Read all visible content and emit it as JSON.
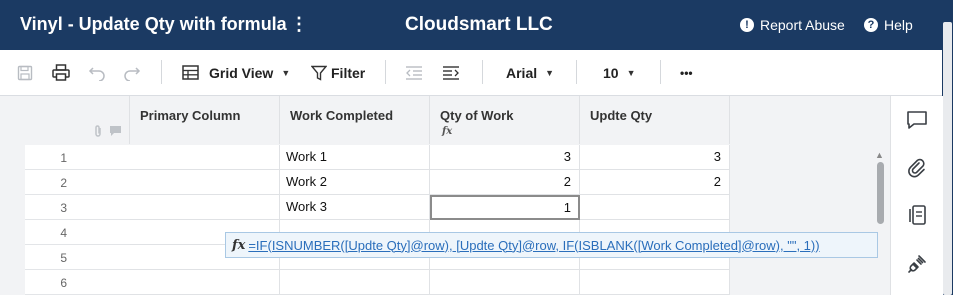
{
  "header": {
    "sheet_title": "Vinyl - Update Qty with formula",
    "menu_glyph": "⋮",
    "company": "Cloudsmart LLC",
    "report_abuse": "Report Abuse",
    "help": "Help",
    "report_icon_glyph": "!",
    "help_icon_glyph": "?"
  },
  "toolbar": {
    "view_label": "Grid View",
    "filter_label": "Filter",
    "font_label": "Arial",
    "font_size": "10",
    "more_label": "•••"
  },
  "columns": [
    {
      "label": "Primary Column",
      "formula": false
    },
    {
      "label": "Work Completed",
      "formula": false
    },
    {
      "label": "Qty of Work",
      "formula": true
    },
    {
      "label": "Updte Qty",
      "formula": false
    }
  ],
  "fx_glyph": "fx",
  "rows": [
    {
      "num": "1",
      "primary": "",
      "work": "Work 1",
      "qty": "3",
      "update": "3"
    },
    {
      "num": "2",
      "primary": "",
      "work": "Work 2",
      "qty": "2",
      "update": "2"
    },
    {
      "num": "3",
      "primary": "",
      "work": "Work 3",
      "qty": "1",
      "update": ""
    },
    {
      "num": "4",
      "primary": "",
      "work": "",
      "qty": "",
      "update": ""
    },
    {
      "num": "5",
      "primary": "",
      "work": "",
      "qty": "",
      "update": ""
    },
    {
      "num": "6",
      "primary": "",
      "work": "",
      "qty": "",
      "update": ""
    }
  ],
  "formula_tip": {
    "icon": "fx",
    "text": "=IF(ISNUMBER([Updte Qty]@row), [Updte Qty]@row, IF(ISBLANK([Work Completed]@row), \"\", 1))"
  },
  "colors": {
    "header_bg": "#1b3a63",
    "formula_link": "#2a6ebb",
    "tip_bg": "#eef5fb"
  }
}
